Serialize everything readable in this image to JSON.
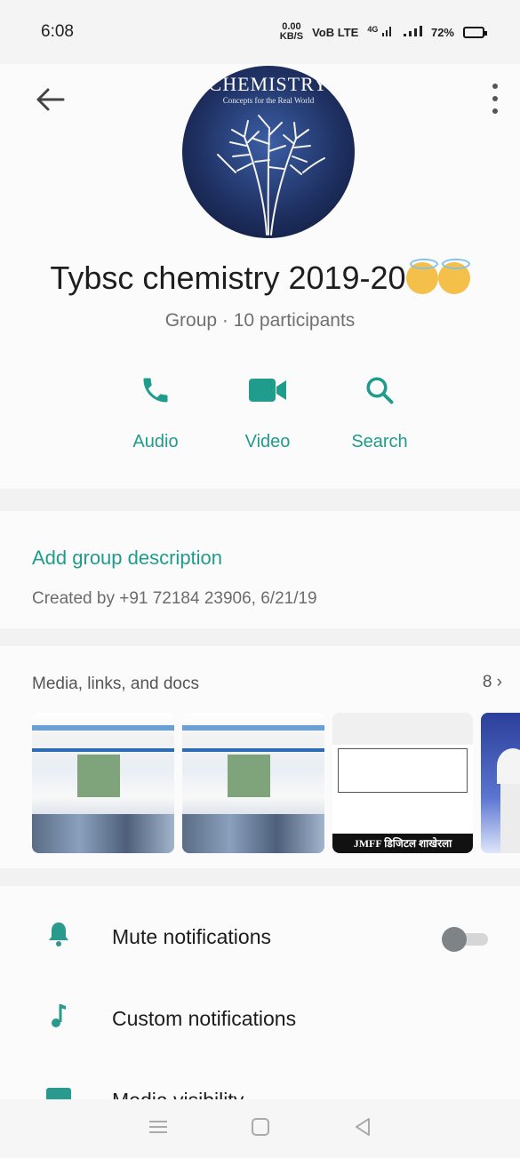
{
  "status_bar": {
    "time": "6:08",
    "net_speed_value": "0.00",
    "net_speed_unit": "KB/S",
    "volte": "VoB LTE",
    "signal_4g": "4G",
    "battery": "72%",
    "battery_level": 0.72
  },
  "header": {
    "avatar_title": "CHEMISTRY",
    "avatar_subtitle": "Concepts for the Real World",
    "group_name": "Tybsc chemistry 2019-20",
    "group_meta": "Group · 10 participants",
    "actions": [
      {
        "label": "Audio",
        "icon": "phone-icon"
      },
      {
        "label": "Video",
        "icon": "video-icon"
      },
      {
        "label": "Search",
        "icon": "search-icon"
      }
    ]
  },
  "description": {
    "add_label": "Add group description",
    "created": "Created by +91 72184 23906, 6/21/19"
  },
  "media": {
    "title": "Media, links, and docs",
    "count": "8",
    "notice_footer": "JMFF डिजिटल शाखेरला"
  },
  "settings": [
    {
      "label": "Mute notifications",
      "icon": "bell-icon",
      "toggle": false
    },
    {
      "label": "Custom notifications",
      "icon": "music-note-icon"
    },
    {
      "label": "Media visibility",
      "icon": "image-icon"
    }
  ],
  "colors": {
    "accent": "#1f9c8c",
    "background": "#f2f2f2",
    "card": "#fbfbfb"
  }
}
